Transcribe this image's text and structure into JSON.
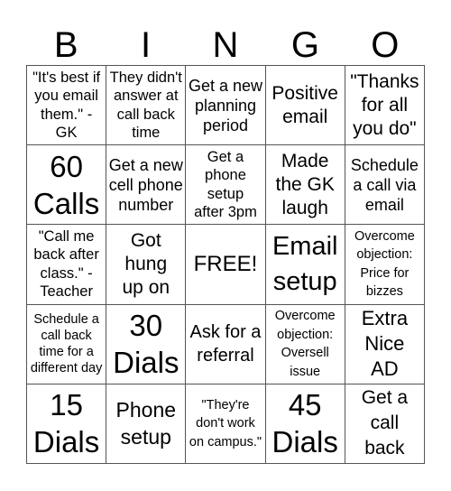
{
  "header": {
    "letters": [
      "B",
      "I",
      "N",
      "G",
      "O"
    ]
  },
  "cells": [
    [
      "\"It's best if you email them.\" - GK",
      "They didn't answer at call back time",
      "Get a new planning period",
      "Positive email",
      "\"Thanks for all you do\""
    ],
    [
      "60 Calls",
      "Get a new cell phone number",
      "Get a phone setup after 3pm",
      "Made the GK laugh",
      "Schedule a call via email"
    ],
    [
      "\"Call me back after class.\" - Teacher",
      "Got hung up on",
      "FREE!",
      "Email setup",
      "Overcome objection: Price for bizzes"
    ],
    [
      "Schedule a call back time for a different day",
      "30 Dials",
      "Ask for a referral",
      "Overcome objection: Oversell issue",
      "Extra Nice AD"
    ],
    [
      "15 Dials",
      "Phone setup",
      "\"They're don't work on campus.\"",
      "45 Dials",
      "Get a call back"
    ]
  ]
}
